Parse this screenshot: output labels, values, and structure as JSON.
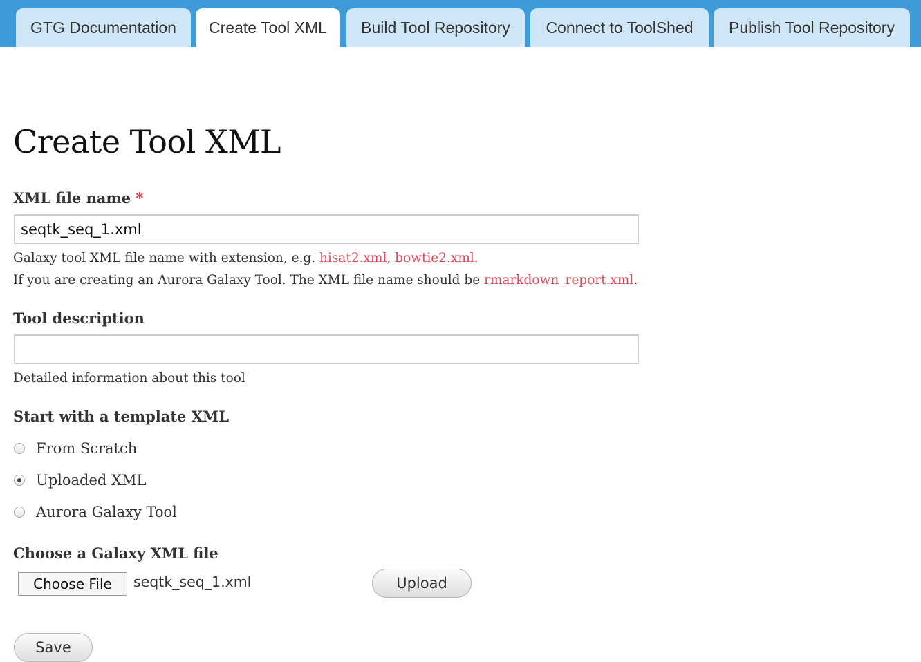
{
  "tabs": [
    {
      "label": "GTG Documentation",
      "active": false
    },
    {
      "label": "Create Tool XML",
      "active": true
    },
    {
      "label": "Build Tool Repository",
      "active": false
    },
    {
      "label": "Connect to ToolShed",
      "active": false
    },
    {
      "label": "Publish Tool Repository",
      "active": false
    }
  ],
  "page": {
    "title": "Create Tool XML"
  },
  "xml_file": {
    "label": "XML file name",
    "required_marker": "*",
    "value": "seqtk_seq_1.xml",
    "help_prefix": "Galaxy tool XML file name with extension, e.g. ",
    "help_examples": "hisat2.xml, bowtie2.xml",
    "help_suffix": ".",
    "aurora_prefix": "If you are creating an Aurora Galaxy Tool. The XML file name should be ",
    "aurora_name": "rmarkdown_report.xml",
    "aurora_suffix": "."
  },
  "tool_description": {
    "label": "Tool description",
    "value": "",
    "help": "Detailed information about this tool"
  },
  "template": {
    "label": "Start with a template XML",
    "options": [
      {
        "label": "From Scratch",
        "checked": false
      },
      {
        "label": "Uploaded XML",
        "checked": true
      },
      {
        "label": "Aurora Galaxy Tool",
        "checked": false
      }
    ]
  },
  "file_chooser": {
    "label": "Choose a Galaxy XML file",
    "button_label": "Choose File",
    "file_name": "seqtk_seq_1.xml",
    "upload_label": "Upload"
  },
  "save_label": "Save",
  "colors": {
    "tabbar": "#3f9ad8",
    "tab": "#cfe6f6",
    "accent_text": "#e0485a",
    "required": "#e0283a"
  }
}
